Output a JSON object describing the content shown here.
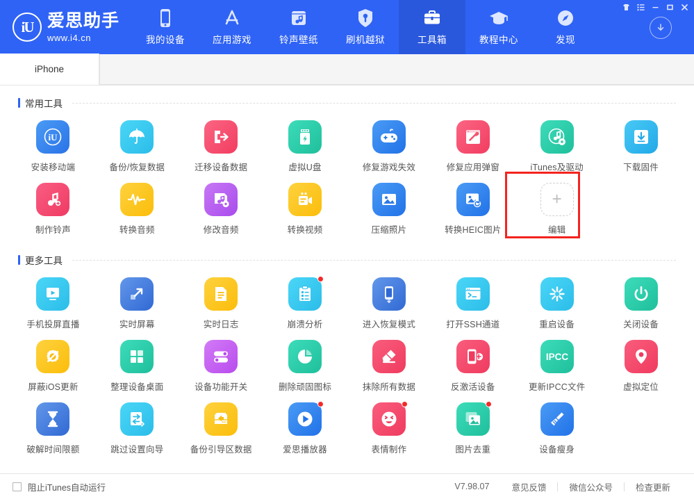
{
  "window": {
    "controls": [
      {
        "name": "skin-button",
        "glyph": "skin"
      },
      {
        "name": "menu-button",
        "glyph": "menu"
      },
      {
        "name": "minimize-button",
        "glyph": "minimize"
      },
      {
        "name": "maximize-button",
        "glyph": "maximize"
      },
      {
        "name": "close-button",
        "glyph": "close"
      }
    ]
  },
  "brand": {
    "mark": "iU",
    "title": "爱思助手",
    "url": "www.i4.cn"
  },
  "nav": {
    "items": [
      {
        "label": "我的设备",
        "icon": "phone-icon",
        "active": false
      },
      {
        "label": "应用游戏",
        "icon": "appstore-icon",
        "active": false
      },
      {
        "label": "铃声壁纸",
        "icon": "ringtone-icon",
        "active": false
      },
      {
        "label": "刷机越狱",
        "icon": "flash-icon",
        "active": false
      },
      {
        "label": "工具箱",
        "icon": "toolbox-icon",
        "active": true
      },
      {
        "label": "教程中心",
        "icon": "graduation-icon",
        "active": false
      },
      {
        "label": "发现",
        "icon": "compass-icon",
        "active": false
      }
    ],
    "download_icon": "download-circle-icon"
  },
  "device_tabs": {
    "items": [
      {
        "label": "iPhone",
        "active": true
      }
    ]
  },
  "sections": [
    {
      "title": "常用工具",
      "tools": [
        {
          "label": "安装移动端",
          "icon": "i4-app-icon",
          "color": "#3b86f0",
          "badge": false
        },
        {
          "label": "备份/恢复数据",
          "icon": "umbrella-icon",
          "color": "#3ec6f0",
          "badge": false
        },
        {
          "label": "迁移设备数据",
          "icon": "migrate-icon",
          "color": "#f9506b",
          "badge": false
        },
        {
          "label": "虚拟U盘",
          "icon": "usb-drive-icon",
          "color": "#27c9a8",
          "badge": false
        },
        {
          "label": "修复游戏失效",
          "icon": "gamepad-icon",
          "color": "#2d86ef",
          "badge": false
        },
        {
          "label": "修复应用弹窗",
          "icon": "repair-popup-icon",
          "color": "#f9506b",
          "badge": false
        },
        {
          "label": "iTunes及驱动",
          "icon": "itunes-gear-icon",
          "color": "#27c9a8",
          "badge": false
        },
        {
          "label": "下载固件",
          "icon": "download-box-icon",
          "color": "#2eb7f0",
          "badge": false
        },
        {
          "label": "制作铃声",
          "icon": "ringtone-add-icon",
          "color": "#f4496d",
          "badge": false
        },
        {
          "label": "转换音频",
          "icon": "waveform-icon",
          "color": "#fcc517",
          "badge": false
        },
        {
          "label": "修改音频",
          "icon": "audio-edit-icon",
          "color": "#bb61ef",
          "badge": false
        },
        {
          "label": "转换视频",
          "icon": "video-convert-icon",
          "color": "#fcc517",
          "badge": false
        },
        {
          "label": "压缩照片",
          "icon": "photo-icon",
          "color": "#2d86ef",
          "badge": false
        },
        {
          "label": "转换HEIC图片",
          "icon": "photo-convert-icon",
          "color": "#2d86ef",
          "badge": false
        },
        {
          "label": "编辑",
          "icon": "plus-icon",
          "color": "",
          "badge": false,
          "placeholder": true,
          "highlighted": true
        }
      ]
    },
    {
      "title": "更多工具",
      "tools": [
        {
          "label": "手机投屏直播",
          "icon": "screen-live-icon",
          "color": "#3ec6f0",
          "badge": false
        },
        {
          "label": "实时屏幕",
          "icon": "realtime-screen-icon",
          "color": "#3b7ee0",
          "badge": false
        },
        {
          "label": "实时日志",
          "icon": "log-file-icon",
          "color": "#fcc517",
          "badge": false
        },
        {
          "label": "崩溃分析",
          "icon": "crash-report-icon",
          "color": "#3ec6f0",
          "badge": true
        },
        {
          "label": "进入恢复模式",
          "icon": "recovery-mode-icon",
          "color": "#3b7ee0",
          "badge": false
        },
        {
          "label": "打开SSH通道",
          "icon": "terminal-icon",
          "color": "#3ec6f0",
          "badge": false
        },
        {
          "label": "重启设备",
          "icon": "restart-icon",
          "color": "#3ec6f0",
          "badge": false
        },
        {
          "label": "关闭设备",
          "icon": "power-icon",
          "color": "#27c9a8",
          "badge": false
        },
        {
          "label": "屏蔽iOS更新",
          "icon": "block-update-icon",
          "color": "#fcc517",
          "badge": false
        },
        {
          "label": "整理设备桌面",
          "icon": "grid-tiles-icon",
          "color": "#27c9a8",
          "badge": false
        },
        {
          "label": "设备功能开关",
          "icon": "toggles-icon",
          "color": "#c561ef",
          "badge": false
        },
        {
          "label": "删除顽固图标",
          "icon": "pie-clock-icon",
          "color": "#27c9a8",
          "badge": false
        },
        {
          "label": "抹除所有数据",
          "icon": "eraser-icon",
          "color": "#f4496d",
          "badge": false
        },
        {
          "label": "反激活设备",
          "icon": "deactivate-icon",
          "color": "#f4496d",
          "badge": false
        },
        {
          "label": "更新IPCC文件",
          "icon": "ipcc-icon",
          "color": "#27c9a8",
          "badge": false,
          "text": "IPCC"
        },
        {
          "label": "虚拟定位",
          "icon": "location-pin-icon",
          "color": "#f4496d",
          "badge": false
        },
        {
          "label": "破解时间限额",
          "icon": "hourglass-icon",
          "color": "#3b7ee0",
          "badge": false
        },
        {
          "label": "跳过设置向导",
          "icon": "skip-wizard-icon",
          "color": "#3ec6f0",
          "badge": false
        },
        {
          "label": "备份引导区数据",
          "icon": "boot-backup-icon",
          "color": "#fcc517",
          "badge": false
        },
        {
          "label": "爱思播放器",
          "icon": "play-circle-icon",
          "color": "#2d7ff0",
          "badge": true
        },
        {
          "label": "表情制作",
          "icon": "emoji-icon",
          "color": "#f4496d",
          "badge": true
        },
        {
          "label": "图片去重",
          "icon": "photo-dedupe-icon",
          "color": "#27c9a8",
          "badge": true
        },
        {
          "label": "设备瘦身",
          "icon": "broom-icon",
          "color": "#3b7ee0",
          "badge": false
        }
      ]
    }
  ],
  "footer": {
    "checkbox_label": "阻止iTunes自动运行",
    "checked": false,
    "version": "V7.98.07",
    "links": [
      "意见反馈",
      "微信公众号",
      "检查更新"
    ]
  },
  "colors": {
    "header_bg": "#2f63f5",
    "accent": "#2f63f5",
    "highlight": "#f4231f"
  }
}
